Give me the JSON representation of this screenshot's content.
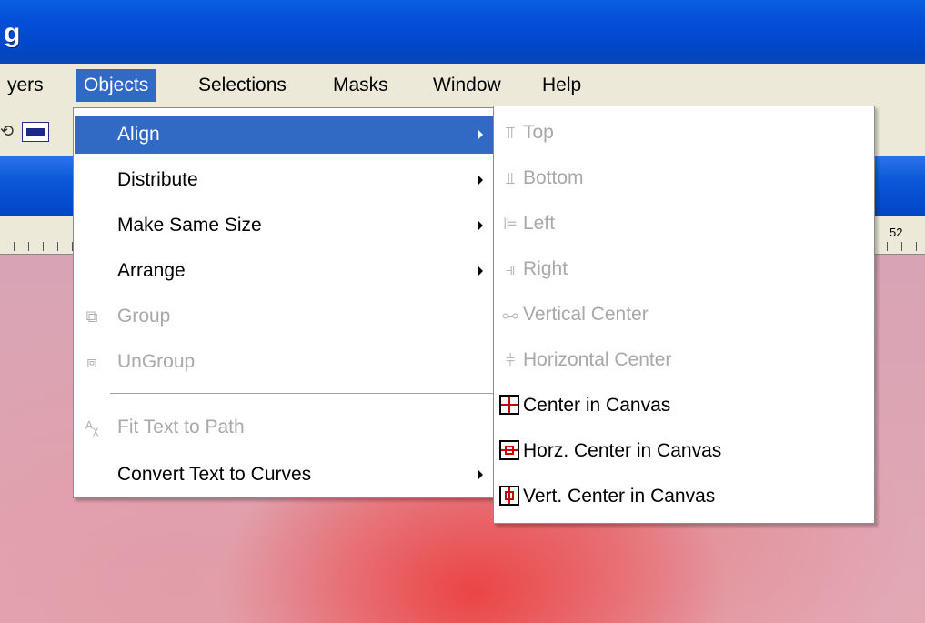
{
  "window": {
    "title_fragment": "g"
  },
  "menubar": {
    "items": [
      {
        "label": "yers",
        "active": false
      },
      {
        "label": "Objects",
        "active": true
      },
      {
        "label": "Selections",
        "active": false
      },
      {
        "label": "Masks",
        "active": false
      },
      {
        "label": "Window",
        "active": false
      },
      {
        "label": "Help",
        "active": false
      }
    ]
  },
  "ruler": {
    "right_label": "52"
  },
  "objects_menu": {
    "items": [
      {
        "label": "Align",
        "submenu": true,
        "highlighted": true,
        "disabled": false,
        "icon": ""
      },
      {
        "label": "Distribute",
        "submenu": true,
        "highlighted": false,
        "disabled": false,
        "icon": ""
      },
      {
        "label": "Make Same Size",
        "submenu": true,
        "highlighted": false,
        "disabled": false,
        "icon": ""
      },
      {
        "label": "Arrange",
        "submenu": true,
        "highlighted": false,
        "disabled": false,
        "icon": ""
      },
      {
        "label": "Group",
        "submenu": false,
        "highlighted": false,
        "disabled": true,
        "icon": "group-icon"
      },
      {
        "label": "UnGroup",
        "submenu": false,
        "highlighted": false,
        "disabled": true,
        "icon": "ungroup-icon"
      },
      {
        "label": "Fit Text to Path",
        "submenu": false,
        "highlighted": false,
        "disabled": true,
        "icon": "fit-text-icon"
      },
      {
        "label": "Convert Text to Curves",
        "submenu": true,
        "highlighted": false,
        "disabled": false,
        "icon": ""
      }
    ]
  },
  "align_menu": {
    "items": [
      {
        "label": "Top",
        "disabled": true,
        "icon": "align-top-icon"
      },
      {
        "label": "Bottom",
        "disabled": true,
        "icon": "align-bottom-icon"
      },
      {
        "label": "Left",
        "disabled": true,
        "icon": "align-left-icon"
      },
      {
        "label": "Right",
        "disabled": true,
        "icon": "align-right-icon"
      },
      {
        "label": "Vertical Center",
        "disabled": true,
        "icon": "vertical-center-icon"
      },
      {
        "label": "Horizontal Center",
        "disabled": true,
        "icon": "horizontal-center-icon"
      },
      {
        "label": "Center in Canvas",
        "disabled": false,
        "icon": "center-in-canvas-icon"
      },
      {
        "label": "Horz. Center in Canvas",
        "disabled": false,
        "icon": "horz-center-in-canvas-icon"
      },
      {
        "label": "Vert. Center in Canvas",
        "disabled": false,
        "icon": "vert-center-in-canvas-icon"
      }
    ]
  },
  "colors": {
    "title_bar": "#0350d8",
    "menu_highlight": "#316ac5",
    "menu_bar_bg": "#ece9d8",
    "disabled_text": "#a8a8a8"
  }
}
